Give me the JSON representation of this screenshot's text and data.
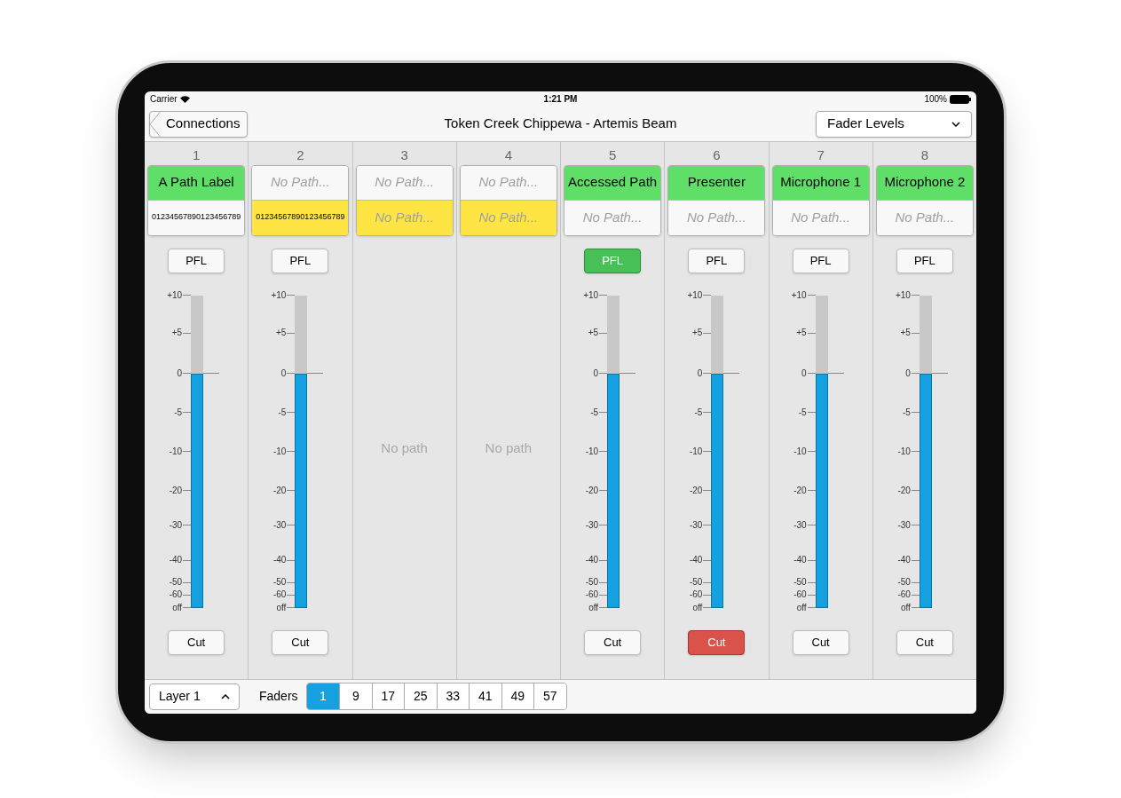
{
  "status_bar": {
    "carrier": "Carrier",
    "time": "1:21 PM",
    "battery": "100%"
  },
  "nav": {
    "back": "Connections",
    "title": "Token Creek Chippewa - Artemis Beam",
    "view_select": "Fader Levels"
  },
  "channels": [
    {
      "kind": "strip",
      "number": "1",
      "top": {
        "text": "A Path Label",
        "color": "#5fdf68",
        "empty": false
      },
      "bottom": {
        "text": "01234567890123456789",
        "color": "#f8f8f8",
        "empty": false
      },
      "pfl": {
        "label": "PFL",
        "on": false
      },
      "scale": [
        "+10",
        "+5",
        "0",
        "-5",
        "-10",
        "-20",
        "-30",
        "-40",
        "-50",
        "-60",
        "off"
      ],
      "level": 0.75,
      "cut": {
        "label": "Cut",
        "on": false
      }
    },
    {
      "kind": "strip",
      "number": "2",
      "top": {
        "text": "No Path...",
        "color": "#f8f8f8",
        "empty": true
      },
      "bottom": {
        "text": "01234567890123456789",
        "color": "#ffe544",
        "empty": false
      },
      "pfl": {
        "label": "PFL",
        "on": false
      },
      "scale": [
        "+10",
        "+5",
        "0",
        "-5",
        "-10",
        "-20",
        "-30",
        "-40",
        "-50",
        "-60",
        "off"
      ],
      "level": 0.75,
      "cut": {
        "label": "Cut",
        "on": false
      }
    },
    {
      "kind": "empty",
      "number": "3",
      "top": {
        "text": "No Path...",
        "color": "#f8f8f8",
        "empty": true
      },
      "bottom": {
        "text": "No Path...",
        "color": "#ffe544",
        "empty": true
      },
      "message": "No path"
    },
    {
      "kind": "empty",
      "number": "4",
      "top": {
        "text": "No Path...",
        "color": "#f8f8f8",
        "empty": true
      },
      "bottom": {
        "text": "No Path...",
        "color": "#ffe544",
        "empty": true
      },
      "message": "No path"
    },
    {
      "kind": "strip",
      "number": "5",
      "top": {
        "text": "Accessed Path",
        "color": "#5fdf68",
        "empty": false
      },
      "bottom": {
        "text": "No Path...",
        "color": "#f8f8f8",
        "empty": true
      },
      "pfl": {
        "label": "PFL",
        "on": true
      },
      "scale": [
        "+10",
        "+5",
        "0",
        "-5",
        "-10",
        "-20",
        "-30",
        "-40",
        "-50",
        "-60",
        "off"
      ],
      "level": 0.75,
      "cut": {
        "label": "Cut",
        "on": false
      }
    },
    {
      "kind": "strip",
      "number": "6",
      "top": {
        "text": "Presenter",
        "color": "#5fdf68",
        "empty": false
      },
      "bottom": {
        "text": "No Path...",
        "color": "#f8f8f8",
        "empty": true
      },
      "pfl": {
        "label": "PFL",
        "on": false
      },
      "scale": [
        "+10",
        "+5",
        "0",
        "-5",
        "-10",
        "-20",
        "-30",
        "-40",
        "-50",
        "-60",
        "off"
      ],
      "level": 0.75,
      "cut": {
        "label": "Cut",
        "on": true
      }
    },
    {
      "kind": "strip",
      "number": "7",
      "top": {
        "text": "Microphone 1",
        "color": "#5fdf68",
        "empty": false
      },
      "bottom": {
        "text": "No Path...",
        "color": "#f8f8f8",
        "empty": true
      },
      "pfl": {
        "label": "PFL",
        "on": false
      },
      "scale": [
        "+10",
        "+5",
        "0",
        "-5",
        "-10",
        "-20",
        "-30",
        "-40",
        "-50",
        "-60",
        "off"
      ],
      "level": 0.75,
      "cut": {
        "label": "Cut",
        "on": false
      }
    },
    {
      "kind": "strip",
      "number": "8",
      "top": {
        "text": "Microphone 2",
        "color": "#5fdf68",
        "empty": false
      },
      "bottom": {
        "text": "No Path...",
        "color": "#f8f8f8",
        "empty": true
      },
      "pfl": {
        "label": "PFL",
        "on": false
      },
      "scale": [
        "+10",
        "+5",
        "0",
        "-5",
        "-10",
        "-20",
        "-30",
        "-40",
        "-50",
        "-60",
        "off"
      ],
      "level": 0.75,
      "cut": {
        "label": "Cut",
        "on": false
      }
    }
  ],
  "bottom_bar": {
    "layer": "Layer 1",
    "faders_label": "Faders",
    "pages": [
      {
        "label": "1",
        "selected": true
      },
      {
        "label": "9",
        "selected": false
      },
      {
        "label": "17",
        "selected": false
      },
      {
        "label": "25",
        "selected": false
      },
      {
        "label": "33",
        "selected": false
      },
      {
        "label": "41",
        "selected": false
      },
      {
        "label": "49",
        "selected": false
      },
      {
        "label": "57",
        "selected": false
      }
    ]
  }
}
